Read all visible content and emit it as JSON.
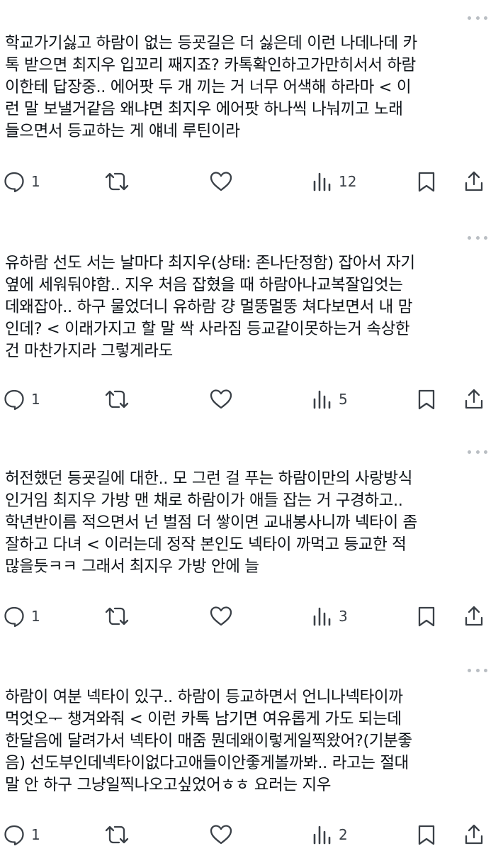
{
  "colors": {
    "text": "#0f1419",
    "icon": "#3a4047",
    "menu_dots": "#b9bec3",
    "background": "#ffffff"
  },
  "icons": {
    "reply": "speech-bubble-icon",
    "retweet": "repost-arrows-icon",
    "like": "heart-icon",
    "views": "bar-chart-icon",
    "bookmark": "bookmark-icon",
    "share": "share-upload-icon",
    "menu": "more-dots-icon"
  },
  "posts": [
    {
      "text": "학교가기싫고 하람이 없는 등굣길은 더 싫은데 이런 나데나데 카\n톡 받으면 최지우 입꼬리 째지죠? 카톡확인하고가만히서서 하람\n이한테 답장중.. 에어팟 두 개 끼는 거 너무 어색해 하라마 < 이\n런 말 보낼거같음 왜냐면 최지우 에어팟 하나씩 나눠끼고 노래\n들으면서 등교하는 게 얘네 루틴이라",
      "replies": "1",
      "retweets": "",
      "likes": "",
      "views": "12"
    },
    {
      "text": "유하람 선도 서는 날마다 최지우(상태: 존나단정함) 잡아서 자기\n옆에 세워둬야함.. 지우 처음 잡혔을 때 하람아나교복잘입엇는\n데왜잡아.. 하구 물었더니 유하람 걍 멀뚱멀뚱 쳐다보면서 내 맘\n인데? < 이래가지고 할 말 싹 사라짐 등교같이못하는거 속상한\n건 마찬가지라 그렇게라도",
      "replies": "1",
      "retweets": "",
      "likes": "",
      "views": "5"
    },
    {
      "text": "허전했던 등굣길에 대한.. 모 그런 걸 푸는 하람이만의 사랑방식\n인거임 최지우 가방 맨 채로 하람이가 애들 잡는 거 구경하고..\n학년반이름 적으면서 넌 벌점 더 쌓이면 교내봉사니까 넥타이 좀\n잘하고 다녀 < 이러는데 정작 본인도 넥타이 까먹고 등교한 적\n많을듯ㅋㅋ 그래서 최지우 가방 안에 늘",
      "replies": "1",
      "retweets": "",
      "likes": "",
      "views": "3"
    },
    {
      "text": "하람이 여분 넥타이 있구.. 하람이 등교하면서 언니나넥타이까\n먹엇오ᅮ 챙겨와줘 < 이런 카톡 남기면 여유롭게 가도 되는데\n한달음에 달려가서 넥타이 매줌 뭔데왜이렇게일찍왔어?(기분좋\n음) 선도부인데넥타이없다고애들이안좋게볼까봐.. 라고는 절대\n말 안 하구 그냥일찍나오고싶었어ㅎㅎ 요러는 지우",
      "replies": "1",
      "retweets": "",
      "likes": "",
      "views": "2"
    }
  ]
}
